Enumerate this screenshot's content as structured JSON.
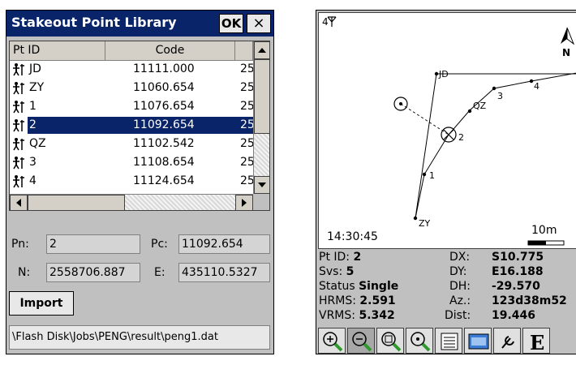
{
  "left": {
    "title": "Stakeout Point Library",
    "ok_label": "OK",
    "close_label": "×",
    "columns": [
      "Pt ID",
      "Code"
    ],
    "rows": [
      {
        "id": "JD",
        "code": "11111.000",
        "ext": "25"
      },
      {
        "id": "ZY",
        "code": "11060.654",
        "ext": "25"
      },
      {
        "id": "1",
        "code": "11076.654",
        "ext": "25"
      },
      {
        "id": "2",
        "code": "11092.654",
        "ext": "25"
      },
      {
        "id": "QZ",
        "code": "11102.542",
        "ext": "25"
      },
      {
        "id": "3",
        "code": "11108.654",
        "ext": "25"
      },
      {
        "id": "4",
        "code": "11124.654",
        "ext": "25"
      }
    ],
    "selected_index": 3,
    "fields": {
      "pn_label": "Pn:",
      "pn_value": "2",
      "pc_label": "Pc:",
      "pc_value": "11092.654",
      "n_label": "N:",
      "n_value": "2558706.887",
      "e_label": "E:",
      "e_value": "435110.5327"
    },
    "import_label": "Import",
    "path": "\\Flash Disk\\Jobs\\PENG\\result\\peng1.dat"
  },
  "right": {
    "signal": "4",
    "north": "N",
    "time": "14:30:45",
    "scale": "10m",
    "map_labels": [
      "JD",
      "4",
      "3",
      "QZ",
      "2",
      "1",
      "ZY"
    ],
    "info": {
      "ptid_label": "Pt ID:",
      "ptid_value": "2",
      "svs_label": "Svs:",
      "svs_value": "5",
      "status_label": "Status",
      "status_value": "Single",
      "hrms_label": "HRMS:",
      "hrms_value": "2.591",
      "vrms_label": "VRMS:",
      "vrms_value": "5.342",
      "dx_label": "DX:",
      "dx_value": "S10.775",
      "dy_label": "DY:",
      "dy_value": "E16.188",
      "dh_label": "DH:",
      "dh_value": "-29.570",
      "az_label": "Az.:",
      "az_value": "123d38m52",
      "dist_label": "Dist:",
      "dist_value": "19.446"
    },
    "toolbar": [
      "zoom-in-icon",
      "zoom-out-icon",
      "zoom-window-icon",
      "zoom-all-icon",
      "list-icon",
      "keyboard-icon",
      "tools-icon",
      "e-icon"
    ],
    "toolbar_e_label": "E"
  },
  "colors": {
    "title_bar": "#0a246a",
    "selection": "#0a246a",
    "window_bg": "#c0c0c0",
    "zoom_icon_green": "#2e9a2e"
  }
}
